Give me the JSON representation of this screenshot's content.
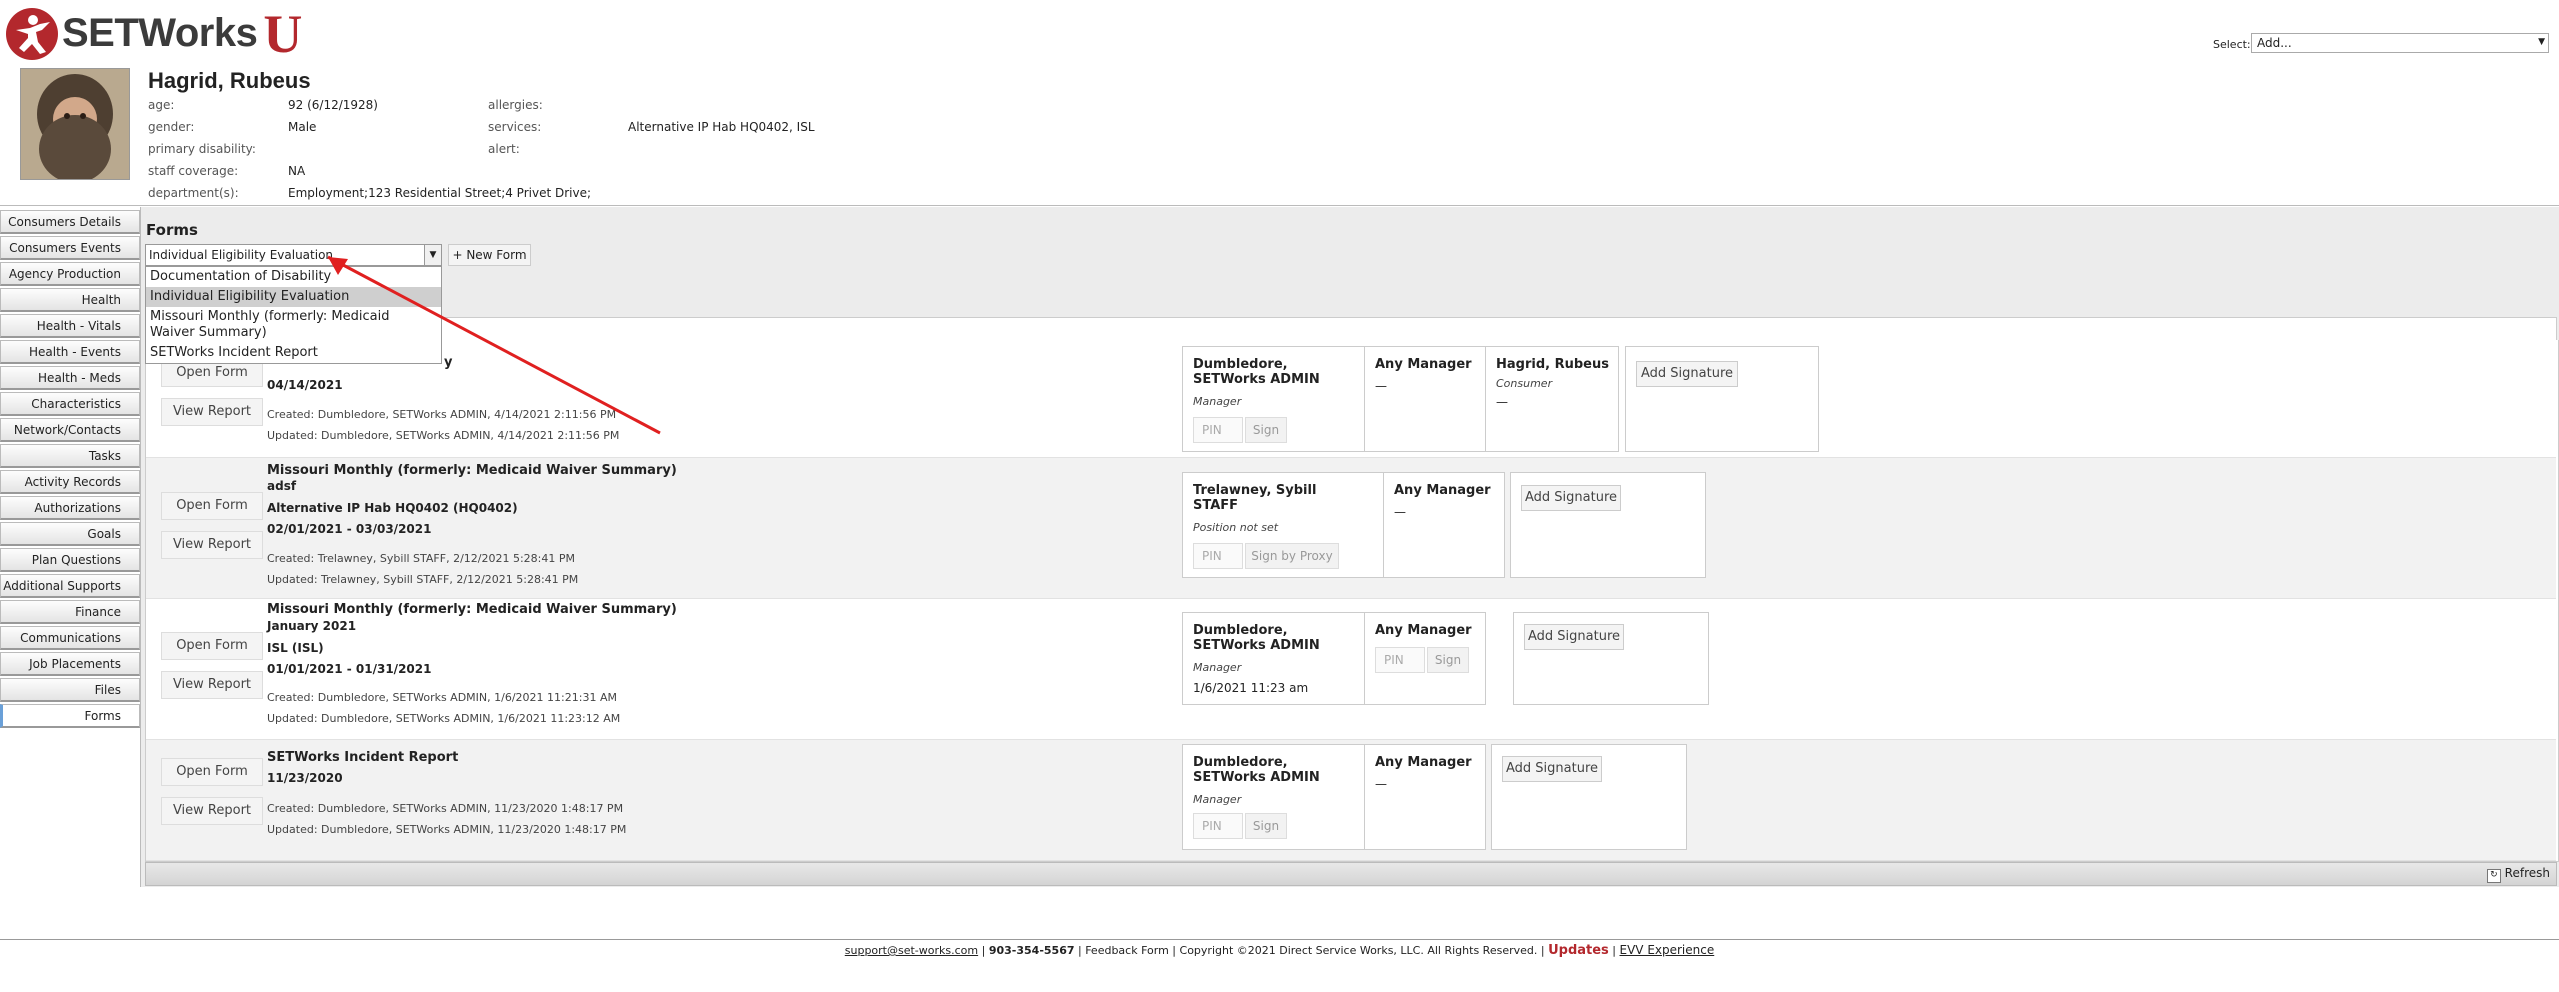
{
  "brand": {
    "name": "SETWorks",
    "suffix": "U"
  },
  "top_select": {
    "label": "Select:",
    "value": "Add..."
  },
  "consumer": {
    "name": "Hagrid, Rubeus",
    "fields": {
      "age_label": "age:",
      "age": "92 (6/12/1928)",
      "gender_label": "gender:",
      "gender": "Male",
      "primary_disability_label": "primary disability:",
      "primary_disability": "",
      "staff_coverage_label": "staff coverage:",
      "staff_coverage": "NA",
      "departments_label": "department(s):",
      "departments": "Employment;123 Residential Street;4 Privet Drive;",
      "allergies_label": "allergies:",
      "allergies": "",
      "services_label": "services:",
      "services": "Alternative IP Hab HQ0402, ISL",
      "alert_label": "alert:",
      "alert": ""
    }
  },
  "sidebar": {
    "items": [
      {
        "label": "Consumers Details"
      },
      {
        "label": "Consumers Events"
      },
      {
        "label": "Agency Production"
      },
      {
        "label": "Health"
      },
      {
        "label": "Health - Vitals"
      },
      {
        "label": "Health - Events"
      },
      {
        "label": "Health - Meds"
      },
      {
        "label": "Characteristics"
      },
      {
        "label": "Network/Contacts"
      },
      {
        "label": "Tasks"
      },
      {
        "label": "Activity Records"
      },
      {
        "label": "Authorizations"
      },
      {
        "label": "Goals"
      },
      {
        "label": "Plan Questions"
      },
      {
        "label": "Additional Supports"
      },
      {
        "label": "Finance"
      },
      {
        "label": "Communications"
      },
      {
        "label": "Job Placements"
      },
      {
        "label": "Files"
      },
      {
        "label": "Forms"
      }
    ]
  },
  "forms": {
    "title": "Forms",
    "selected": "Individual Eligibility Evaluation",
    "new_form_label": "+ New Form",
    "dropdown_options": [
      "Documentation of Disability",
      "Individual Eligibility Evaluation",
      "Missouri Monthly (formerly: Medicaid Waiver Summary)",
      "SETWorks Incident Report"
    ],
    "rows": [
      {
        "title": "y",
        "line1": "",
        "line2": "",
        "date": "04/14/2021",
        "open_label": "Open Form",
        "view_label": "View Report",
        "created": "Created: Dumbledore, SETWorks ADMIN, 4/14/2021 2:11:56 PM",
        "updated": "Updated: Dumbledore, SETWorks ADMIN, 4/14/2021 2:11:56 PM",
        "sig1": {
          "name": "Dumbledore, SETWorks ADMIN",
          "role": "Manager",
          "pin": "PIN",
          "sign": "Sign"
        },
        "sig2": {
          "name": "Any Manager",
          "dash": "—"
        },
        "sig3": {
          "name": "Hagrid, Rubeus",
          "role": "Consumer",
          "dash": "—"
        },
        "add": "Add Signature"
      },
      {
        "title": "Missouri Monthly (formerly: Medicaid Waiver Summary)",
        "line1": "adsf",
        "line2": "Alternative IP Hab HQ0402 (HQ0402)",
        "date": "02/01/2021 - 03/03/2021",
        "open_label": "Open Form",
        "view_label": "View Report",
        "created": "Created: Trelawney, Sybill STAFF, 2/12/2021 5:28:41 PM",
        "updated": "Updated: Trelawney, Sybill STAFF, 2/12/2021 5:28:41 PM",
        "sig1": {
          "name": "Trelawney, Sybill STAFF",
          "role": "Position not set",
          "pin": "PIN",
          "sign": "Sign by Proxy"
        },
        "sig2": {
          "name": "Any Manager",
          "dash": "—"
        },
        "add": "Add Signature"
      },
      {
        "title": "Missouri Monthly (formerly: Medicaid Waiver Summary)",
        "line1": "January 2021",
        "line2": "ISL (ISL)",
        "date": "01/01/2021 - 01/31/2021",
        "open_label": "Open Form",
        "view_label": "View Report",
        "created": "Created: Dumbledore, SETWorks ADMIN, 1/6/2021 11:21:31 AM",
        "updated": "Updated: Dumbledore, SETWorks ADMIN, 1/6/2021 11:23:12 AM",
        "sig1": {
          "name": "Dumbledore, SETWorks ADMIN",
          "role": "Manager",
          "signed": "1/6/2021 11:23 am"
        },
        "sig2": {
          "name": "Any Manager",
          "pin": "PIN",
          "sign": "Sign"
        },
        "add": "Add Signature"
      },
      {
        "title": "SETWorks Incident Report",
        "line1": "11/23/2020",
        "open_label": "Open Form",
        "view_label": "View Report",
        "created": "Created: Dumbledore, SETWorks ADMIN, 11/23/2020 1:48:17 PM",
        "updated": "Updated: Dumbledore, SETWorks ADMIN, 11/23/2020 1:48:17 PM",
        "sig1": {
          "name": "Dumbledore, SETWorks ADMIN",
          "role": "Manager",
          "pin": "PIN",
          "sign": "Sign"
        },
        "sig2": {
          "name": "Any Manager",
          "dash": "—"
        },
        "add": "Add Signature"
      }
    ],
    "refresh_label": "Refresh"
  },
  "footer": {
    "email": "support@set-works.com",
    "phone": "903-354-5567",
    "feedback": "Feedback Form",
    "copyright": "Copyright ©2021 Direct Service Works, LLC. All Rights Reserved.",
    "updates": "Updates",
    "evv": "EVV Experience"
  },
  "colors": {
    "brand_red": "#b3282d",
    "annotation_arrow": "#e02020"
  }
}
